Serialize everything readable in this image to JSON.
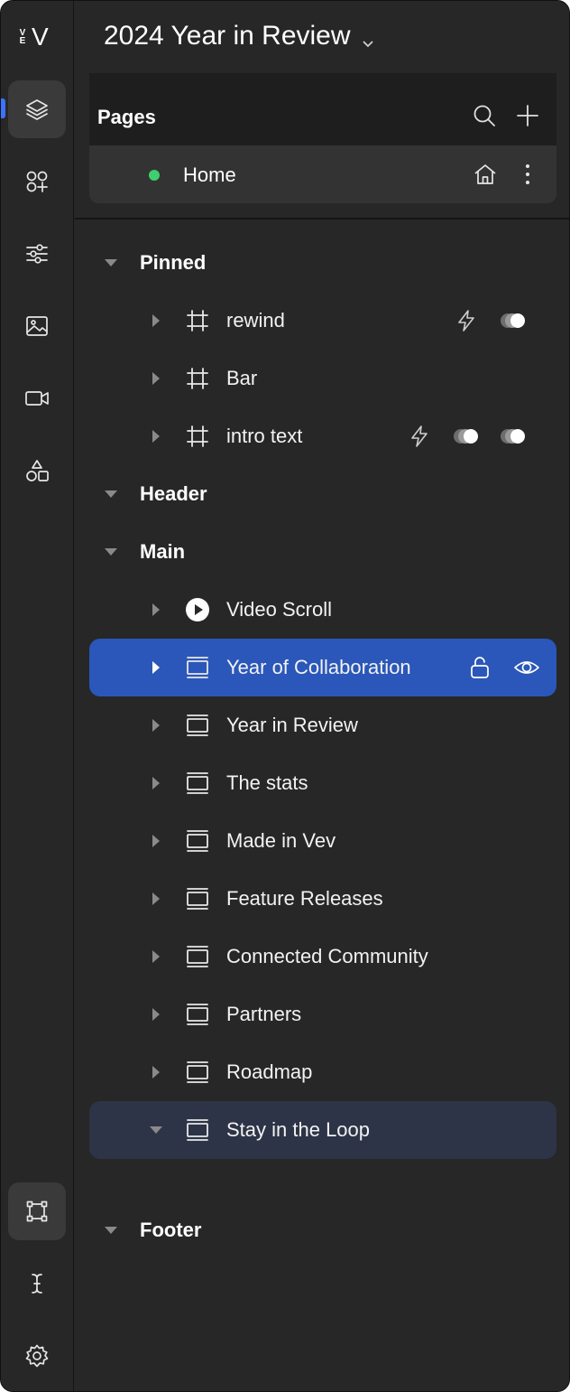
{
  "app": {
    "logo_small": "V E",
    "logo_big": "V",
    "accent": "#3b73ff",
    "selected_row_color": "#2a57b9",
    "highlight_row_color": "#2e3447",
    "status_dot_color": "#3ecf6e"
  },
  "rail": {
    "icons": [
      "layers-icon",
      "add-element-icon",
      "adjustments-icon",
      "image-icon",
      "video-icon",
      "shapes-icon",
      "frame-select-icon",
      "text-cursor-icon",
      "settings-icon"
    ]
  },
  "header": {
    "title": "2024 Year in Review"
  },
  "pages": {
    "label": "Pages",
    "home_label": "Home"
  },
  "tree": {
    "sections": {
      "pinned": "Pinned",
      "header": "Header",
      "main": "Main",
      "footer": "Footer"
    },
    "pinned_items": [
      "rewind",
      "Bar",
      "intro text"
    ],
    "main_items": [
      "Video Scroll",
      "Year of Collaboration",
      "Year in Review",
      "The stats",
      "Made in Vev",
      "Feature Releases",
      "Connected Community",
      "Partners",
      "Roadmap",
      "Stay in the Loop"
    ],
    "selected_item": "Year of Collaboration"
  }
}
